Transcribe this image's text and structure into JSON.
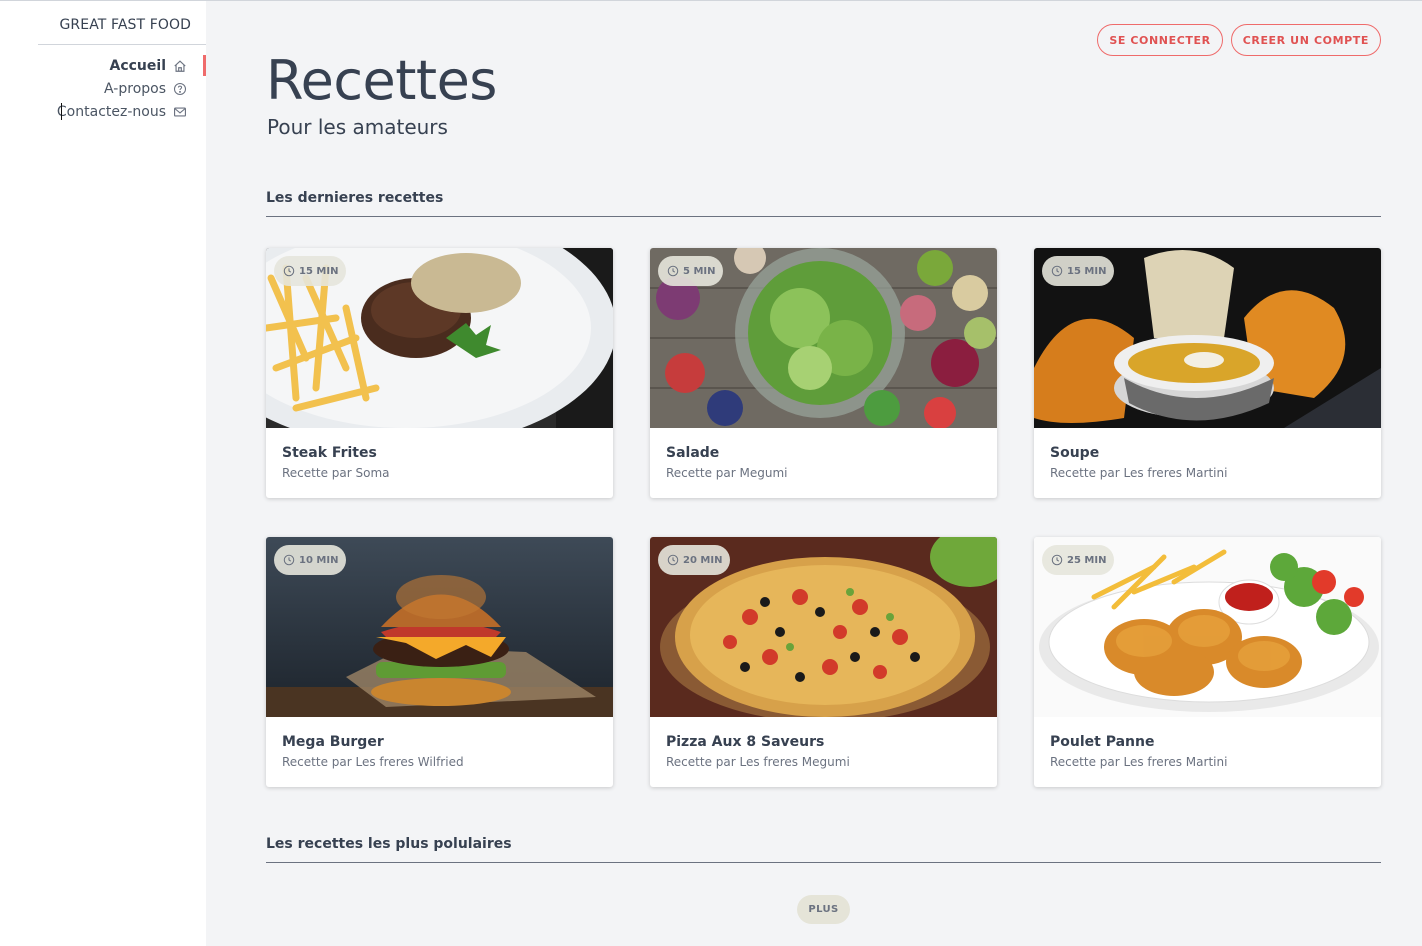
{
  "sidebar": {
    "brand": "GREAT FAST FOOD",
    "items": [
      {
        "label": "Accueil",
        "icon": "home-icon",
        "active": true
      },
      {
        "label": "A-propos",
        "icon": "question-circle-icon",
        "active": false
      },
      {
        "label": "Contactez-nous",
        "icon": "mail-icon",
        "active": false
      }
    ]
  },
  "header": {
    "login_label": "SE CONNECTER",
    "signup_label": "CREER UN COMPTE",
    "title": "Recettes",
    "subtitle": "Pour les amateurs"
  },
  "sections": {
    "latest": "Les dernieres recettes",
    "popular": "Les recettes les plus polulaires"
  },
  "recipes": [
    {
      "time": "15 MIN",
      "title": "Steak Frites",
      "author": "Recette par Soma",
      "image": "steak-fries-image"
    },
    {
      "time": "5 MIN",
      "title": "Salade",
      "author": "Recette par Megumi",
      "image": "salad-image"
    },
    {
      "time": "15 MIN",
      "title": "Soupe",
      "author": "Recette par Les freres Martini",
      "image": "soup-image"
    },
    {
      "time": "10 MIN",
      "title": "Mega Burger",
      "author": "Recette par Les freres Wilfried",
      "image": "burger-image"
    },
    {
      "time": "20 MIN",
      "title": "Pizza Aux 8 Saveurs",
      "author": "Recette par Les freres Megumi",
      "image": "pizza-image"
    },
    {
      "time": "25 MIN",
      "title": "Poulet Panne",
      "author": "Recette par Les freres Martini",
      "image": "fried-chicken-image"
    }
  ],
  "more_label": "PLUS",
  "colors": {
    "accent": "#ef6b6b",
    "background": "#f3f4f6",
    "text": "#374151"
  }
}
